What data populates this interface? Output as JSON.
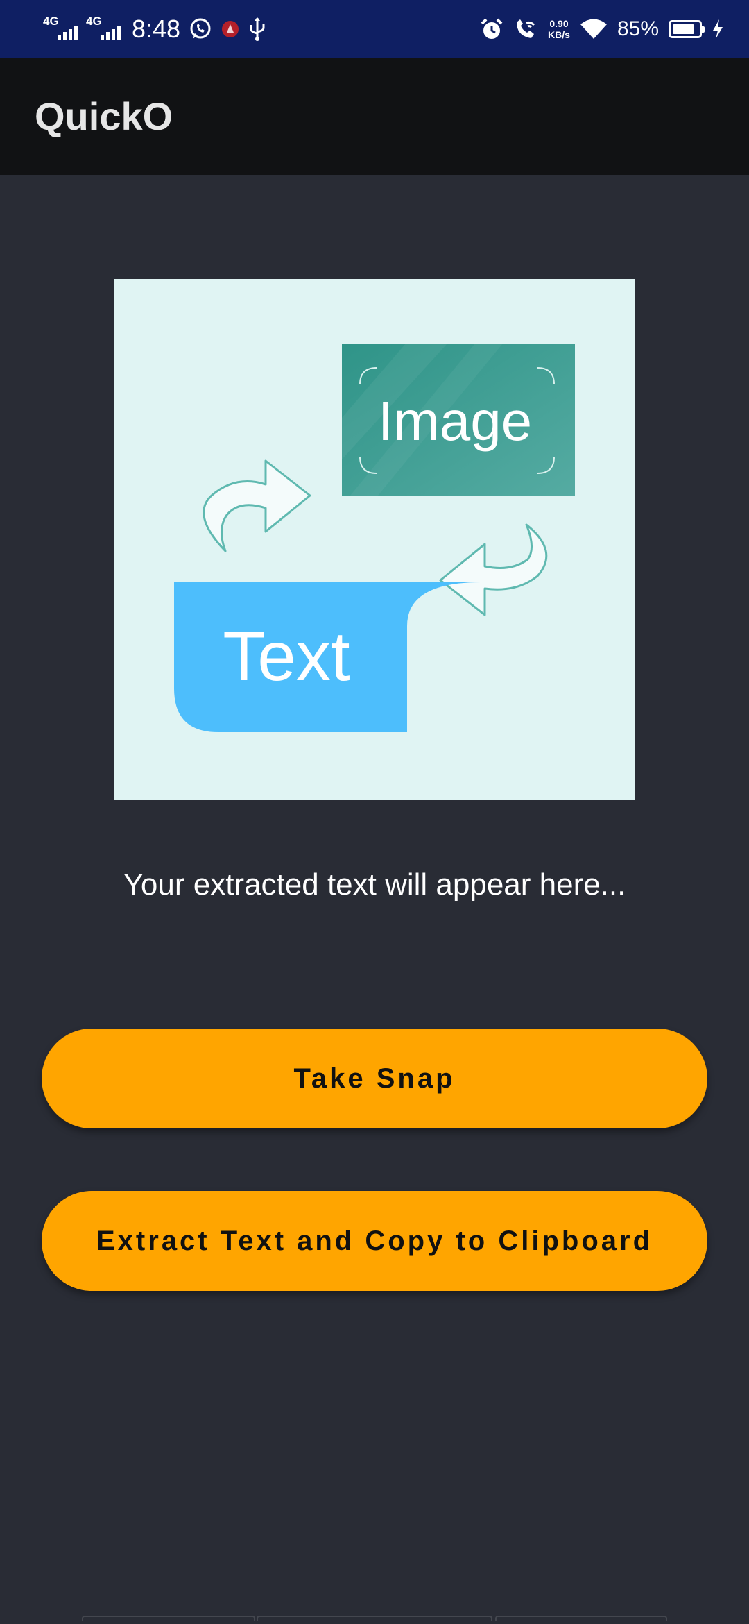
{
  "status_bar": {
    "network_1": "4G",
    "network_2": "4G",
    "time": "8:48",
    "speed_value": "0.90",
    "speed_unit": "KB/s",
    "battery_percent": "85%",
    "battery_level": 0.85,
    "icons": [
      "whatsapp-icon",
      "notification-icon",
      "usb-icon",
      "alarm-icon",
      "wifi-calling-icon",
      "wifi-icon",
      "battery-icon",
      "charging-icon"
    ]
  },
  "app_bar": {
    "title": "QuickO"
  },
  "illustration": {
    "image_label": "Image",
    "text_label": "Text",
    "colors": {
      "background": "#e0f4f3",
      "image_card": "#3d9e94",
      "text_bubble": "#4dbefc",
      "arrow_outline": "#5fb9b0"
    }
  },
  "main": {
    "extracted_text": "Your extracted text will appear here...",
    "take_snap_label": "Take Snap",
    "extract_label": "Extract Text and Copy to Clipboard"
  },
  "theme": {
    "background": "#292c35",
    "status_bar": "#0f1f63",
    "app_bar": "#111214",
    "button": "#ffa500"
  }
}
